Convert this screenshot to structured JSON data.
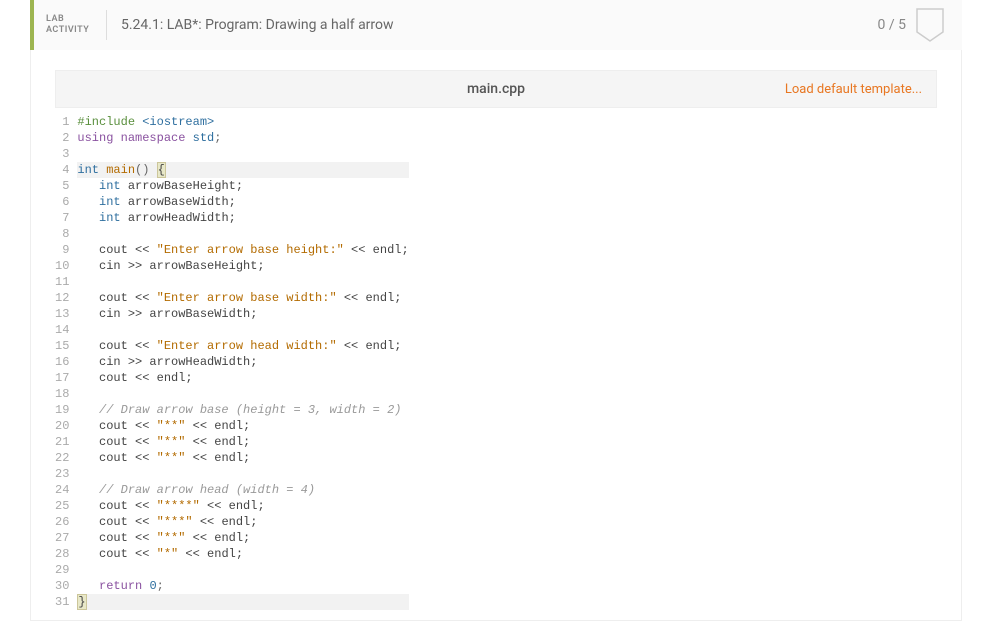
{
  "header": {
    "tag_line1": "LAB",
    "tag_line2": "ACTIVITY",
    "title": "5.24.1: LAB*: Program: Drawing a half arrow",
    "score": "0 / 5"
  },
  "filebar": {
    "filename": "main.cpp",
    "load_template": "Load default template..."
  },
  "code": {
    "lines": [
      {
        "n": 1,
        "tokens": [
          {
            "t": "#include",
            "c": "tok-pre"
          },
          {
            "t": " "
          },
          {
            "t": "<iostream>",
            "c": "tok-id"
          }
        ]
      },
      {
        "n": 2,
        "tokens": [
          {
            "t": "using",
            "c": "tok-kw2"
          },
          {
            "t": " "
          },
          {
            "t": "namespace",
            "c": "tok-kw2"
          },
          {
            "t": " "
          },
          {
            "t": "std",
            "c": "tok-id"
          },
          {
            "t": ";",
            "c": "tok-punct"
          }
        ]
      },
      {
        "n": 3,
        "tokens": []
      },
      {
        "n": 4,
        "hl": true,
        "tokens": [
          {
            "t": "int",
            "c": "tok-type"
          },
          {
            "t": " "
          },
          {
            "t": "main",
            "c": "tok-func"
          },
          {
            "t": "() ",
            "c": "tok-punct"
          },
          {
            "t": "{",
            "c": "brace-hl"
          }
        ]
      },
      {
        "n": 5,
        "tokens": [
          {
            "t": "   "
          },
          {
            "t": "int",
            "c": "tok-type"
          },
          {
            "t": " arrowBaseHeight;"
          }
        ]
      },
      {
        "n": 6,
        "tokens": [
          {
            "t": "   "
          },
          {
            "t": "int",
            "c": "tok-type"
          },
          {
            "t": " arrowBaseWidth;"
          }
        ]
      },
      {
        "n": 7,
        "tokens": [
          {
            "t": "   "
          },
          {
            "t": "int",
            "c": "tok-type"
          },
          {
            "t": " arrowHeadWidth;"
          }
        ]
      },
      {
        "n": 8,
        "tokens": []
      },
      {
        "n": 9,
        "tokens": [
          {
            "t": "   cout << "
          },
          {
            "t": "\"Enter arrow base height:\"",
            "c": "tok-str"
          },
          {
            "t": " << endl;"
          }
        ]
      },
      {
        "n": 10,
        "tokens": [
          {
            "t": "   cin >> arrowBaseHeight;"
          }
        ]
      },
      {
        "n": 11,
        "tokens": []
      },
      {
        "n": 12,
        "tokens": [
          {
            "t": "   cout << "
          },
          {
            "t": "\"Enter arrow base width:\"",
            "c": "tok-str"
          },
          {
            "t": " << endl;"
          }
        ]
      },
      {
        "n": 13,
        "tokens": [
          {
            "t": "   cin >> arrowBaseWidth;"
          }
        ]
      },
      {
        "n": 14,
        "tokens": []
      },
      {
        "n": 15,
        "tokens": [
          {
            "t": "   cout << "
          },
          {
            "t": "\"Enter arrow head width:\"",
            "c": "tok-str"
          },
          {
            "t": " << endl;"
          }
        ]
      },
      {
        "n": 16,
        "tokens": [
          {
            "t": "   cin >> arrowHeadWidth;"
          }
        ]
      },
      {
        "n": 17,
        "tokens": [
          {
            "t": "   cout << endl;"
          }
        ]
      },
      {
        "n": 18,
        "tokens": []
      },
      {
        "n": 19,
        "tokens": [
          {
            "t": "   "
          },
          {
            "t": "// Draw arrow base (height = 3, width = 2)",
            "c": "tok-cmt"
          }
        ]
      },
      {
        "n": 20,
        "tokens": [
          {
            "t": "   cout << "
          },
          {
            "t": "\"**\"",
            "c": "tok-str"
          },
          {
            "t": " << endl;"
          }
        ]
      },
      {
        "n": 21,
        "tokens": [
          {
            "t": "   cout << "
          },
          {
            "t": "\"**\"",
            "c": "tok-str"
          },
          {
            "t": " << endl;"
          }
        ]
      },
      {
        "n": 22,
        "tokens": [
          {
            "t": "   cout << "
          },
          {
            "t": "\"**\"",
            "c": "tok-str"
          },
          {
            "t": " << endl;"
          }
        ]
      },
      {
        "n": 23,
        "tokens": []
      },
      {
        "n": 24,
        "tokens": [
          {
            "t": "   "
          },
          {
            "t": "// Draw arrow head (width = 4)",
            "c": "tok-cmt"
          }
        ]
      },
      {
        "n": 25,
        "tokens": [
          {
            "t": "   cout << "
          },
          {
            "t": "\"****\"",
            "c": "tok-str"
          },
          {
            "t": " << endl;"
          }
        ]
      },
      {
        "n": 26,
        "tokens": [
          {
            "t": "   cout << "
          },
          {
            "t": "\"***\"",
            "c": "tok-str"
          },
          {
            "t": " << endl;"
          }
        ]
      },
      {
        "n": 27,
        "tokens": [
          {
            "t": "   cout << "
          },
          {
            "t": "\"**\"",
            "c": "tok-str"
          },
          {
            "t": " << endl;"
          }
        ]
      },
      {
        "n": 28,
        "tokens": [
          {
            "t": "   cout << "
          },
          {
            "t": "\"*\"",
            "c": "tok-str"
          },
          {
            "t": " << endl;"
          }
        ]
      },
      {
        "n": 29,
        "tokens": []
      },
      {
        "n": 30,
        "tokens": [
          {
            "t": "   "
          },
          {
            "t": "return",
            "c": "tok-kw2"
          },
          {
            "t": " "
          },
          {
            "t": "0",
            "c": "tok-num"
          },
          {
            "t": ";",
            "c": "tok-punct"
          }
        ]
      },
      {
        "n": 31,
        "hl": true,
        "tokens": [
          {
            "t": "}",
            "c": "brace-hl"
          }
        ]
      }
    ]
  }
}
